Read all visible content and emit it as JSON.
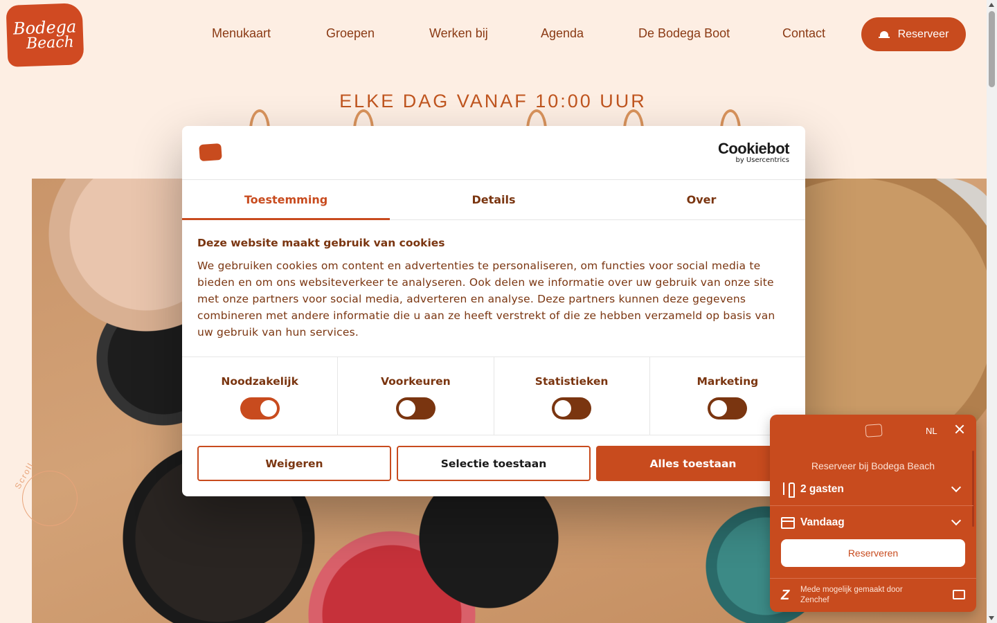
{
  "header": {
    "logo_line1": "Bodega",
    "logo_line2": "Beach",
    "nav": [
      "Menukaart",
      "Groepen",
      "Werken bij",
      "Agenda",
      "De Bodega Boot",
      "Contact"
    ],
    "reserve_label": "Reserveer"
  },
  "hero": {
    "tagline": "ELKE DAG VANAF 10:00 UUR",
    "scroll_label": "Scroll"
  },
  "cookie": {
    "brand": "Cookiebot",
    "brand_sub": "by Usercentrics",
    "tabs": [
      "Toestemming",
      "Details",
      "Over"
    ],
    "active_tab": "Toestemming",
    "heading": "Deze website maakt gebruik van cookies",
    "text": "We gebruiken cookies om content en advertenties te personaliseren, om functies voor social media te bieden en om ons websiteverkeer te analyseren. Ook delen we informatie over uw gebruik van onze site met onze partners voor social media, adverteren en analyse. Deze partners kunnen deze gegevens combineren met andere informatie die u aan ze heeft verstrekt of die ze hebben verzameld op basis van uw gebruik van hun services.",
    "toggles": [
      {
        "label": "Noodzakelijk",
        "on": true
      },
      {
        "label": "Voorkeuren",
        "on": false
      },
      {
        "label": "Statistieken",
        "on": false
      },
      {
        "label": "Marketing",
        "on": false
      }
    ],
    "buttons": {
      "deny": "Weigeren",
      "selection": "Selectie toestaan",
      "allow_all": "Alles toestaan"
    }
  },
  "widget": {
    "language": "NL",
    "title": "Reserveer bij Bodega Beach",
    "guests": "2 gasten",
    "date": "Vandaag",
    "reserve_button": "Reserveren",
    "footer_text": "Mede mogelijk gemaakt door Zenchef",
    "footer_logo": "Z"
  },
  "colors": {
    "background": "#fdeee3",
    "accent": "#c84b1e",
    "text_dark": "#7a3510"
  }
}
